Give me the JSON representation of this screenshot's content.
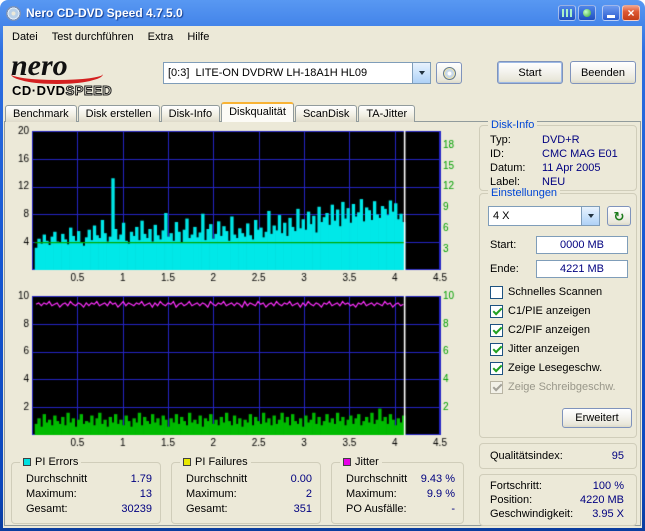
{
  "window": {
    "title": "Nero CD-DVD Speed 4.7.5.0"
  },
  "menu": {
    "items": [
      "Datei",
      "Test durchführen",
      "Extra",
      "Hilfe"
    ]
  },
  "logo": {
    "word": "nero",
    "sub1": "CD·DVD",
    "sub2": "SPEED"
  },
  "toolbar": {
    "drive": "[0:3]  LITE-ON DVDRW LH-18A1H HL09",
    "start": "Start",
    "quit": "Beenden"
  },
  "tabs": [
    "Benchmark",
    "Disk erstellen",
    "Disk-Info",
    "Diskqualität",
    "ScanDisk",
    "TA-Jitter"
  ],
  "active_tab": 3,
  "disk_info": {
    "title": "Disk-Info",
    "rows": [
      {
        "label": "Typ:",
        "value": "DVD+R"
      },
      {
        "label": "ID:",
        "value": "CMC MAG E01"
      },
      {
        "label": "Datum:",
        "value": "11 Apr 2005"
      },
      {
        "label": "Label:",
        "value": "NEU"
      }
    ]
  },
  "settings": {
    "title": "Einstellungen",
    "speed": "4 X",
    "start_label": "Start:",
    "start_value": "0000 MB",
    "end_label": "Ende:",
    "end_value": "4221 MB",
    "checkboxes": [
      {
        "label": "Schnelles Scannen",
        "checked": false,
        "disabled": false
      },
      {
        "label": "C1/PIE anzeigen",
        "checked": true,
        "disabled": false
      },
      {
        "label": "C2/PIF anzeigen",
        "checked": true,
        "disabled": false
      },
      {
        "label": "Jitter anzeigen",
        "checked": true,
        "disabled": false
      },
      {
        "label": "Zeige Lesegeschw.",
        "checked": true,
        "disabled": false
      },
      {
        "label": "Zeige Schreibgeschw.",
        "checked": true,
        "disabled": true
      }
    ],
    "advanced": "Erweitert"
  },
  "quality": {
    "label": "Qualitätsindex:",
    "value": "95"
  },
  "progress": {
    "rows": [
      {
        "label": "Fortschritt:",
        "value": "100 %"
      },
      {
        "label": "Position:",
        "value": "4220 MB"
      },
      {
        "label": "Geschwindigkeit:",
        "value": "3.95 X"
      }
    ]
  },
  "legends": [
    {
      "title": "PI Errors",
      "color": "#00E0E0",
      "rows": [
        [
          "Durchschnitt",
          "1.79"
        ],
        [
          "Maximum:",
          "13"
        ],
        [
          "Gesamt:",
          "30239"
        ]
      ]
    },
    {
      "title": "PI Failures",
      "color": "#E8E800",
      "rows": [
        [
          "Durchschnitt",
          "0.00"
        ],
        [
          "Maximum:",
          "2"
        ],
        [
          "Gesamt:",
          "351"
        ]
      ]
    },
    {
      "title": "Jitter",
      "color": "#E800E8",
      "rows": [
        [
          "Durchschnitt",
          "9.43 %"
        ],
        [
          "Maximum:",
          "9.9 %"
        ],
        [
          "PO Ausfälle:",
          "-"
        ]
      ]
    }
  ],
  "chart_data": [
    {
      "type": "bar",
      "name": "pi-errors-with-read-speed",
      "xlim": [
        0,
        4.5
      ],
      "ylim": [
        0,
        20
      ],
      "x_ticks": [
        0.5,
        1,
        1.5,
        2,
        2.5,
        3,
        3.5,
        4,
        4.5
      ],
      "y_ticks_left": [
        4,
        8,
        12,
        16,
        20
      ],
      "y_ticks_right": [
        3,
        6,
        9,
        12,
        15,
        18
      ],
      "x_start": 0.03,
      "x_end": 4.11,
      "grid_color": "#2525C5",
      "bar_color": "#00E8E8",
      "right_label_color": "#00A000",
      "bars": [
        3.2,
        4.5,
        3.8,
        5.1,
        4.2,
        3.6,
        4.8,
        5.5,
        4.1,
        3.9,
        5.2,
        4.4,
        3.7,
        6.1,
        4.9,
        4.2,
        5.6,
        4.0,
        3.5,
        4.7,
        5.8,
        4.3,
        6.4,
        5.0,
        4.6,
        7.2,
        5.3,
        4.1,
        4.8,
        13.2,
        5.9,
        4.4,
        5.1,
        6.8,
        4.2,
        3.8,
        5.5,
        4.9,
        6.2,
        4.3,
        7.1,
        5.2,
        4.6,
        5.9,
        4.1,
        6.5,
        5.0,
        4.4,
        5.7,
        8.2,
        4.8,
        5.3,
        4.2,
        6.9,
        5.5,
        4.0,
        5.8,
        7.4,
        4.6,
        5.1,
        6.2,
        4.7,
        5.4,
        8.1,
        4.3,
        5.9,
        6.6,
        4.5,
        5.2,
        7.0,
        4.9,
        6.3,
        5.6,
        4.2,
        7.7,
        5.1,
        4.6,
        6.0,
        5.3,
        4.8,
        6.7,
        5.0,
        4.4,
        7.2,
        5.8,
        6.1,
        4.7,
        5.5,
        8.5,
        5.2,
        6.4,
        5.7,
        7.9,
        5.3,
        6.8,
        4.9,
        7.5,
        6.2,
        5.6,
        8.8,
        6.0,
        7.3,
        5.8,
        8.4,
        6.6,
        7.8,
        5.4,
        9.1,
        6.9,
        7.6,
        8.2,
        6.5,
        9.4,
        7.1,
        8.7,
        6.3,
        9.8,
        7.4,
        8.9,
        6.8,
        9.5,
        7.7,
        8.3,
        10.2,
        7.0,
        9.0,
        8.6,
        7.2,
        9.9,
        8.0,
        7.5,
        9.2,
        8.8,
        7.9,
        10.0,
        8.4,
        9.6,
        7.3,
        8.1,
        6.9
      ],
      "lines": [
        {
          "name": "read-speed",
          "color": "#00A800",
          "constant": 3.95
        }
      ],
      "marker_x": 4.11,
      "marker_color": "#FFFFFF"
    },
    {
      "type": "bar",
      "name": "pi-failures-with-jitter",
      "xlim": [
        0,
        4.5
      ],
      "ylim": [
        0,
        10
      ],
      "x_ticks": [
        0.5,
        1,
        1.5,
        2,
        2.5,
        3,
        3.5,
        4,
        4.5
      ],
      "y_ticks_left": [
        2,
        4,
        6,
        8,
        10
      ],
      "y_ticks_right": [
        2,
        4,
        6,
        8,
        10
      ],
      "x_start": 0.03,
      "x_end": 4.11,
      "grid_color": "#2525C5",
      "bar_color": "#00BB00",
      "right_label_color": "#00A000",
      "bars": [
        0.8,
        1.2,
        0.6,
        1.5,
        0.9,
        1.1,
        0.7,
        1.4,
        1.0,
        0.8,
        1.3,
        0.7,
        1.6,
        0.9,
        1.2,
        0.6,
        1.1,
        1.5,
        0.8,
        1.0,
        0.9,
        1.4,
        0.7,
        1.2,
        1.6,
        0.8,
        1.1,
        0.6,
        1.3,
        0.9,
        1.5,
        0.8,
        1.1,
        0.7,
        1.4,
        1.0,
        0.6,
        1.2,
        0.9,
        1.6,
        0.7,
        1.3,
        1.0,
        0.8,
        1.5,
        0.9,
        1.2,
        0.7,
        1.4,
        1.1,
        0.6,
        1.2,
        0.9,
        1.5,
        0.8,
        1.3,
        1.0,
        0.7,
        1.6,
        0.9,
        1.1,
        0.8,
        1.4,
        0.6,
        1.2,
        1.0,
        1.5,
        0.8,
        1.1,
        0.7,
        1.3,
        0.9,
        1.6,
        1.0,
        0.7,
        1.4,
        0.8,
        1.2,
        0.6,
        1.1,
        0.9,
        1.5,
        0.7,
        1.3,
        1.0,
        0.8,
        1.6,
        0.9,
        1.2,
        0.7,
        1.4,
        0.8,
        1.1,
        1.6,
        0.9,
        1.3,
        0.7,
        1.5,
        1.0,
        0.8,
        1.2,
        0.6,
        1.4,
        0.9,
        1.1,
        1.6,
        0.8,
        1.3,
        0.7,
        1.0,
        1.5,
        0.9,
        1.2,
        0.8,
        1.6,
        1.0,
        1.3,
        0.7,
        1.1,
        1.4,
        0.8,
        1.2,
        1.5,
        0.7,
        1.0,
        1.3,
        0.9,
        1.6,
        0.8,
        1.1,
        1.9,
        1.0,
        1.3,
        0.8,
        1.5,
        1.1,
        0.7,
        1.2,
        0.9,
        1.4
      ],
      "lines": [
        {
          "name": "jitter",
          "color": "#FF30FF",
          "values": [
            9.4,
            9.5,
            9.3,
            9.5,
            9.4,
            9.6,
            9.3,
            9.4,
            9.5,
            9.2,
            9.4,
            9.5,
            9.3,
            9.6,
            9.4,
            9.3,
            9.5,
            9.4,
            9.2,
            9.5,
            9.3,
            9.5,
            9.4,
            9.6,
            9.3,
            9.4,
            9.5,
            9.3,
            9.6,
            9.4,
            9.5,
            9.2,
            9.4,
            9.6,
            9.3,
            9.5,
            9.4,
            9.3,
            9.5,
            9.4,
            9.6,
            9.3,
            9.4,
            9.5,
            9.2,
            9.5,
            9.3,
            9.6,
            9.4,
            9.3,
            9.5,
            9.4,
            9.6,
            9.2,
            9.4,
            9.5,
            9.3,
            9.4,
            9.6,
            9.3,
            9.4,
            9.5,
            9.3,
            9.5,
            9.4,
            9.2,
            9.6,
            9.4,
            9.3,
            9.5,
            9.4,
            9.6,
            9.3,
            9.4,
            9.5,
            9.3,
            9.5,
            9.4,
            9.2,
            9.6,
            9.3,
            9.5,
            9.4,
            9.3,
            9.6,
            9.4,
            9.5,
            9.2,
            9.4,
            9.5,
            9.3,
            9.6,
            9.4,
            9.3,
            9.5,
            9.4,
            9.6,
            9.3,
            9.4,
            9.5,
            9.2,
            9.5,
            9.3,
            9.6,
            9.4,
            9.3,
            9.5,
            9.4,
            9.2,
            9.5,
            9.4,
            9.6,
            9.3,
            9.4,
            9.5,
            9.3,
            9.6,
            9.4,
            9.5,
            9.3,
            9.4,
            9.2,
            9.5,
            9.4,
            9.6,
            9.3,
            9.4,
            9.5,
            9.3,
            9.5,
            9.4,
            9.3,
            9.6,
            9.4,
            9.5,
            9.2,
            9.4,
            9.5,
            9.3,
            9.4
          ]
        }
      ],
      "marker_x": 4.11,
      "marker_color": "#FFFFFF"
    }
  ]
}
